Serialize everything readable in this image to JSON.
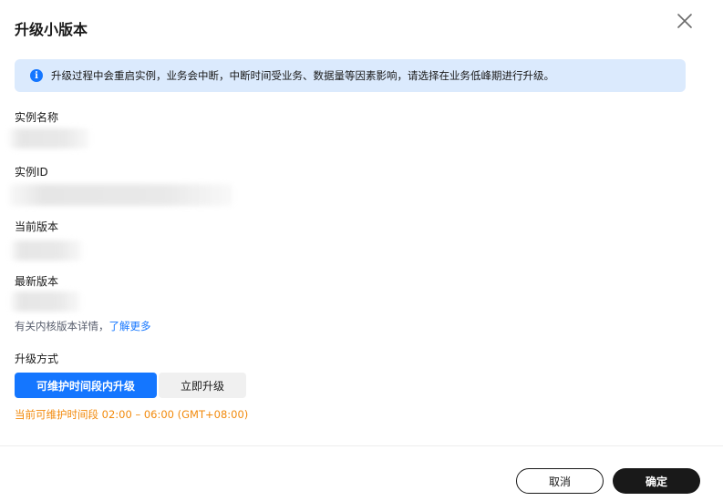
{
  "dialog": {
    "title": "升级小版本",
    "close_icon": "close-icon"
  },
  "notice": {
    "icon": "info-icon",
    "icon_glyph": "i",
    "text": "升级过程中会重启实例，业务会中断，中断时间受业务、数据量等因素影响，请选择在业务低峰期进行升级。"
  },
  "fields": {
    "instance_name_label": "实例名称",
    "instance_id_label": "实例ID",
    "current_version_label": "当前版本",
    "latest_version_label": "最新版本"
  },
  "help": {
    "prefix": "有关内核版本详情，",
    "link": "了解更多"
  },
  "upgrade_mode": {
    "label": "升级方式",
    "options": [
      "可维护时间段内升级",
      "立即升级"
    ],
    "selected": "可维护时间段内升级",
    "window_hint": "当前可维护时间段 02:00 – 06:00 (GMT+08:00)"
  },
  "footer": {
    "cancel": "取消",
    "confirm": "确定"
  },
  "colors": {
    "accent": "#1476ff",
    "notice_bg": "#dbeafd",
    "warning_text": "#f28a0c",
    "primary_button": "#191919"
  }
}
